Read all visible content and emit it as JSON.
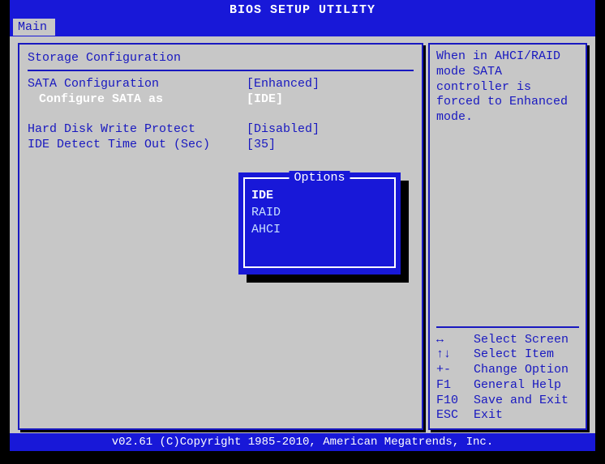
{
  "title": "BIOS SETUP UTILITY",
  "tab": "Main",
  "section": "Storage Configuration",
  "settings": {
    "sata_config": {
      "label": "SATA Configuration",
      "value": "[Enhanced]"
    },
    "configure_sata_as": {
      "label": "Configure SATA as",
      "value": "[IDE]"
    },
    "hd_write_protect": {
      "label": "Hard Disk Write Protect",
      "value": "[Disabled]"
    },
    "ide_detect_timeout": {
      "label": "IDE Detect Time Out (Sec)",
      "value": "[35]"
    }
  },
  "popup": {
    "title": "Options",
    "options": [
      "IDE",
      "RAID",
      "AHCI"
    ],
    "selected": "IDE"
  },
  "help": {
    "text": "When in AHCI/RAID mode SATA controller is forced to Enhanced mode."
  },
  "keys": [
    {
      "key": "↔",
      "action": "Select Screen"
    },
    {
      "key": "↑↓",
      "action": "Select Item"
    },
    {
      "key": "+-",
      "action": "Change Option"
    },
    {
      "key": "F1",
      "action": "General Help"
    },
    {
      "key": "F10",
      "action": "Save and Exit"
    },
    {
      "key": "ESC",
      "action": "Exit"
    }
  ],
  "footer": "v02.61 (C)Copyright 1985-2010, American Megatrends, Inc."
}
